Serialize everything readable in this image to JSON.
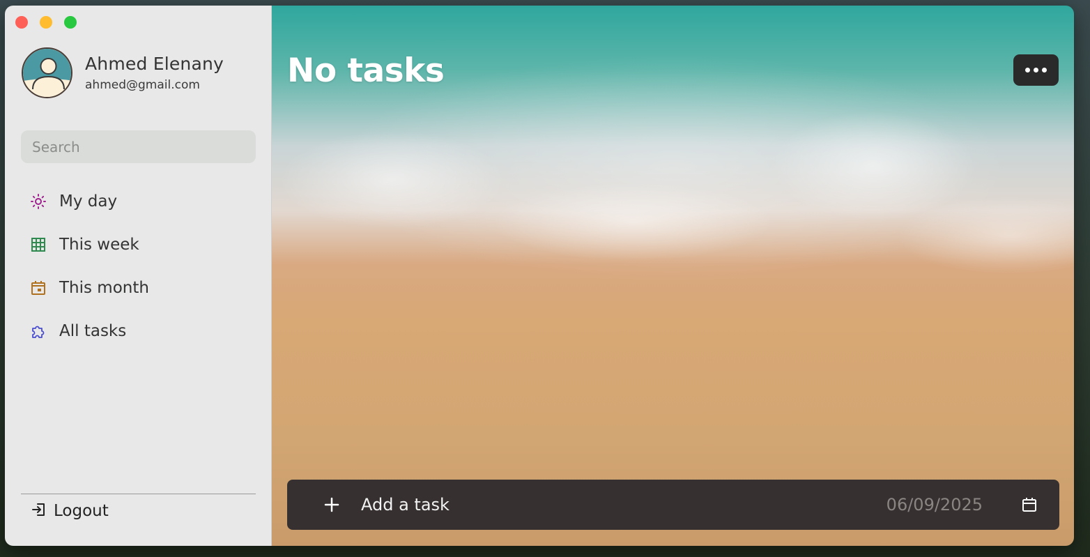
{
  "window": {
    "controls": [
      "close",
      "minimize",
      "maximize"
    ]
  },
  "user": {
    "name": "Ahmed Elenany",
    "email": "ahmed@gmail.com"
  },
  "search": {
    "placeholder": "Search"
  },
  "nav": {
    "items": [
      {
        "label": "My day",
        "icon": "sun-icon",
        "color": "#a0228f"
      },
      {
        "label": "This week",
        "icon": "grid-calendar-icon",
        "color": "#2e8a4e"
      },
      {
        "label": "This month",
        "icon": "calendar-icon",
        "color": "#b0711f"
      },
      {
        "label": "All tasks",
        "icon": "puzzle-icon",
        "color": "#4a4ccf"
      }
    ]
  },
  "logout": {
    "label": "Logout",
    "icon": "logout-icon"
  },
  "main": {
    "title": "No tasks",
    "more_icon": "more-horizontal-icon"
  },
  "add_task": {
    "placeholder": "Add a task",
    "date": "06/09/2025",
    "icon": "plus-icon",
    "date_icon": "calendar-icon"
  }
}
